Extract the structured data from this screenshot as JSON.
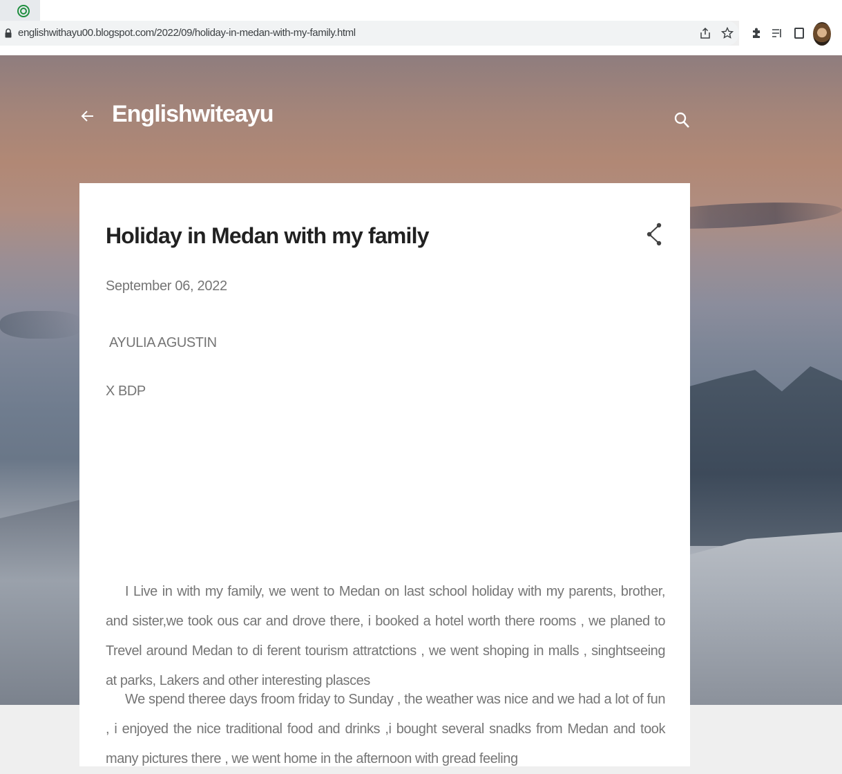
{
  "browser": {
    "url": "englishwithayu00.blogspot.com/2022/09/holiday-in-medan-with-my-family.html",
    "icons": [
      "tab-favicon-icon",
      "lock-icon",
      "share-page-icon",
      "bookmark-star-icon",
      "extensions-puzzle-icon",
      "reading-list-icon",
      "side-panel-icon",
      "profile-avatar"
    ]
  },
  "blog": {
    "title": "Englishwiteayu",
    "icons": [
      "back-arrow-icon",
      "search-icon"
    ]
  },
  "post": {
    "title": "Holiday in Medan with my family",
    "date": "September 06, 2022",
    "author": "AYULIA AGUSTIN",
    "class": "X BDP",
    "paragraphs": [
      "I Live in with my family, we went to Medan on last school holiday with my parents, brother, and sister,we took ous car and drove there, i booked a hotel worth there rooms , we planed to Trevel around Medan to di ferent tourism attratctions , we went shoping in malls , singhtseeing at parks, Lakers and other interesting plasces",
      "We spend theree days froom friday to Sunday , the weather was nice and we had a lot of fun , i enjoyed the nice traditional  food and drinks ,i bought  several snadks from Medan and took many pictures there , we went home in  the afternoon with gread feeling"
    ],
    "icons": [
      "share-icon"
    ]
  },
  "colors": {
    "chrome_bar": "#f1f3f4",
    "favicon": "#1e8e3e",
    "card": "#ffffff",
    "title_text": "#212121",
    "body_text": "#757575",
    "page_bg": "#efefef"
  }
}
